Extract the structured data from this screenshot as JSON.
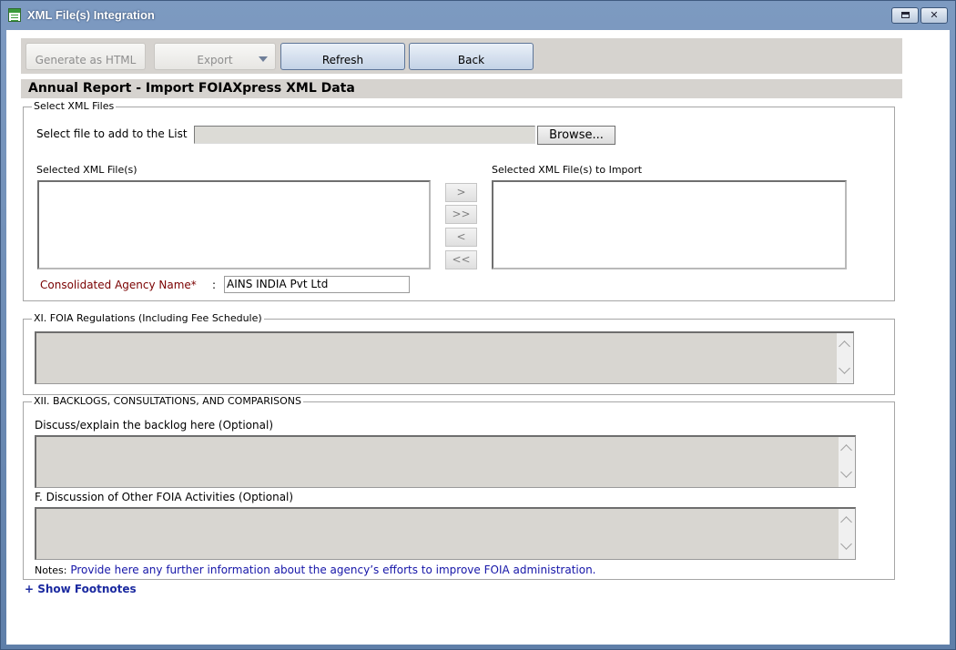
{
  "window": {
    "title": "XML File(s) Integration",
    "maximize_glyph": "",
    "close_glyph": "✕"
  },
  "toolbar": {
    "generate_html_label": "Generate as HTML",
    "export_label": "Export",
    "refresh_label": "Refresh",
    "back_label": "Back"
  },
  "page": {
    "title": "Annual Report - Import FOIAXpress XML Data"
  },
  "select_files": {
    "legend": "Select XML Files",
    "select_label": "Select file to add to the List",
    "file_value": "",
    "browse_label": "Browse...",
    "selected_files_label": "Selected XML File(s)",
    "selected_import_label": "Selected XML File(s) to Import",
    "move_buttons": [
      ">",
      ">>",
      "<",
      "<<"
    ],
    "agency_label": "Consolidated Agency Name*",
    "agency_separator": ":",
    "agency_value": "AINS INDIA Pvt Ltd"
  },
  "regulations": {
    "legend": "XI. FOIA Regulations (Including Fee Schedule)"
  },
  "backlogs": {
    "legend": "XII. BACKLOGS, CONSULTATIONS, AND COMPARISONS",
    "backlog_label": "Discuss/explain the backlog here (Optional)",
    "other_label": "F. Discussion of Other FOIA Activities (Optional)",
    "notes_label": "Notes:",
    "notes_text": "Provide here any further information about the agency’s efforts to improve FOIA administration."
  },
  "footer": {
    "show_footnotes": "+ Show Footnotes"
  }
}
